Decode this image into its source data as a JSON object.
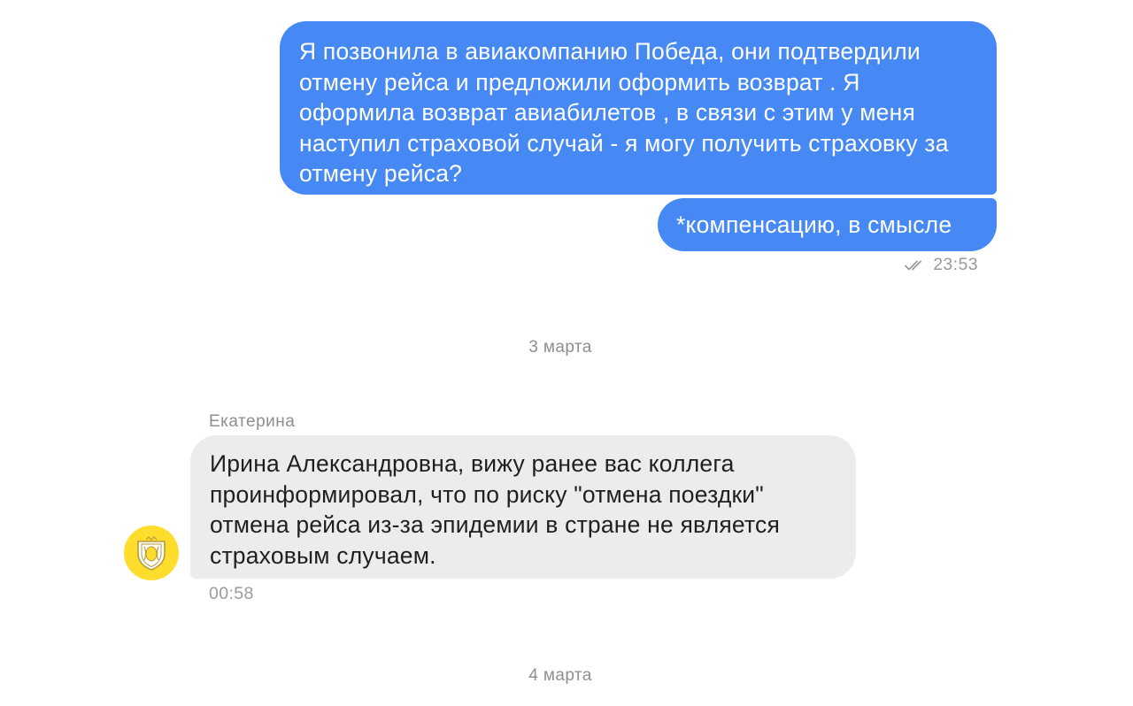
{
  "messages": {
    "outgoing_1": "Я позвонила в авиакомпанию Победа, они подтвердили отмену рейса и предложили оформить возврат . Я оформила возврат авиабилетов , в связи с этим у меня наступил страховой случай - я могу получить страховку за отмену рейса?",
    "outgoing_2": "*компенсацию, в смысле",
    "outgoing_time": "23:53",
    "outgoing_status_icon": "double-check-icon",
    "date_separator_1": "3 марта",
    "incoming_sender": "Екатерина",
    "incoming_1": "Ирина Александровна, вижу ранее вас коллега проинформировал, что по риску \"отмена поездки\" отмена рейса из-за эпидемии в стране не является страховым случаем.",
    "incoming_time": "00:58",
    "incoming_avatar_icon": "tinkoff-logo-icon",
    "date_separator_2": "4 марта"
  },
  "colors": {
    "outgoing_bubble": "#4689f4",
    "incoming_bubble": "#ececef",
    "avatar_bg": "#ffdd2d",
    "meta_text": "#8e8e93"
  }
}
